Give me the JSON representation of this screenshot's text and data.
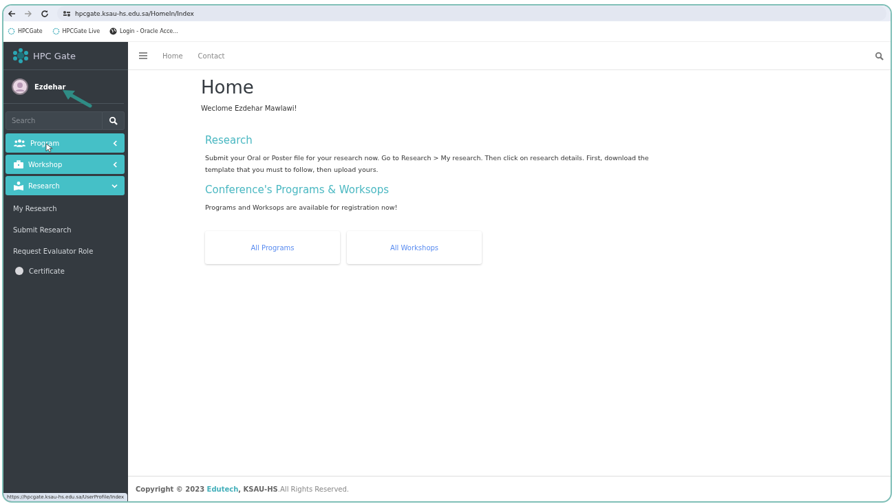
{
  "browser": {
    "url": "hpcgate.ksau-hs.edu.sa/HomeIn/Index",
    "bookmarks": [
      {
        "label": "HPCGate",
        "kind": "site"
      },
      {
        "label": "HPCGate Live",
        "kind": "site"
      },
      {
        "label": "Login - Oracle Acce...",
        "kind": "globe"
      }
    ],
    "status_url": "https://hpcgate.ksau-hs.edu.sa/UserProfile/Index"
  },
  "sidebar": {
    "brand": "HPC Gate",
    "user": "Ezdehar",
    "search": {
      "placeholder": "Search"
    },
    "menu": [
      {
        "kind": "group",
        "label": "Program",
        "expanded": false
      },
      {
        "kind": "group",
        "label": "Workshop",
        "expanded": false
      },
      {
        "kind": "group",
        "label": "Research",
        "expanded": true,
        "children": [
          {
            "label": "My Research"
          },
          {
            "label": "Submit Research"
          },
          {
            "label": "Request Evaluator Role"
          }
        ]
      },
      {
        "kind": "plain",
        "label": "Certificate"
      }
    ]
  },
  "topnav": {
    "links": [
      "Home",
      "Contact"
    ]
  },
  "main": {
    "title": "Home",
    "welcome": "Weclome Ezdehar Mawlawi!",
    "sections": [
      {
        "heading": "Research",
        "text": "Submit your Oral or Poster file for your research now. Go to Research > My research. Then click on research details. First, download the template that you must to follow, then upload yours."
      },
      {
        "heading": "Conference's Programs & Worksops",
        "text": "Programs and Worksops are available for registration now!"
      }
    ],
    "cards": [
      "All Programs",
      "All Workshops"
    ]
  },
  "footer": {
    "prefix": "Copyright © 2023",
    "link": "Edutech",
    "suffix": "**, KSAU-HS**.All Rights Reserved."
  }
}
